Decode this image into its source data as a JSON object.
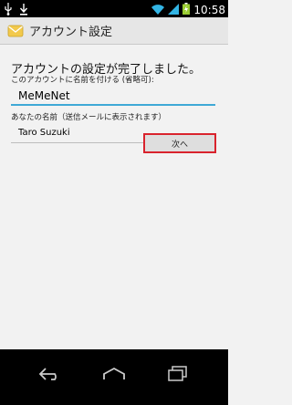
{
  "status_bar": {
    "time": "10:58"
  },
  "action_bar": {
    "title": "アカウント設定",
    "icon": "mail-icon"
  },
  "main": {
    "heading": "アカウントの設定が完了しました。",
    "account_name_label": "このアカウントに名前を付ける (省略可):",
    "account_name_value": "MeMeNet",
    "your_name_label": "あなたの名前（送信メールに表示されます）",
    "your_name_value": "Taro Suzuki",
    "next_button_label": "次へ"
  },
  "colors": {
    "accent_underline": "#3fa9d6",
    "highlight_border": "#d9232d",
    "battery": "#9acd32"
  },
  "icons": [
    "usb-icon",
    "download-icon",
    "wifi-icon",
    "signal-icon",
    "battery-icon",
    "back-icon",
    "home-icon",
    "recent-apps-icon"
  ]
}
